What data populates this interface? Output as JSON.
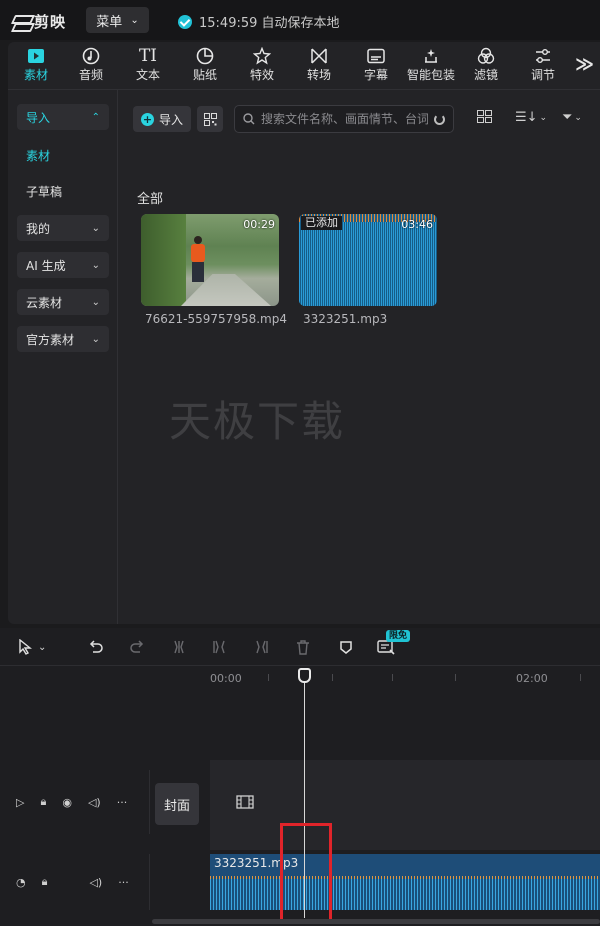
{
  "app": {
    "logo_text": "剪映",
    "menu_label": "菜单",
    "save_status": "15:49:59 自动保存本地"
  },
  "toolbar": {
    "tools": [
      {
        "label": "素材",
        "icon": "media-icon",
        "active": true
      },
      {
        "label": "音频",
        "icon": "audio-icon"
      },
      {
        "label": "文本",
        "icon": "text-icon"
      },
      {
        "label": "贴纸",
        "icon": "sticker-icon"
      },
      {
        "label": "特效",
        "icon": "effects-icon"
      },
      {
        "label": "转场",
        "icon": "transition-icon"
      },
      {
        "label": "字幕",
        "icon": "subtitle-icon"
      },
      {
        "label": "智能包装",
        "icon": "smart-package-icon"
      },
      {
        "label": "滤镜",
        "icon": "filter-icon"
      },
      {
        "label": "调节",
        "icon": "adjust-icon"
      }
    ],
    "more": "≫"
  },
  "sidebar": {
    "items": [
      {
        "label": "导入",
        "expandable": true,
        "active": true
      },
      {
        "label": "素材",
        "selected": true
      },
      {
        "label": "子草稿"
      },
      {
        "label": "我的",
        "expandable": true
      },
      {
        "label": "AI 生成",
        "expandable": true
      },
      {
        "label": "云素材",
        "expandable": true
      },
      {
        "label": "官方素材",
        "expandable": true
      }
    ]
  },
  "content": {
    "import_label": "导入",
    "search_placeholder": "搜索文件名称、画面情节、台词",
    "section_label": "全部",
    "media": [
      {
        "name": "76621-559757958.mp4",
        "duration": "00:29",
        "type": "video"
      },
      {
        "name": "3323251.mp3",
        "duration": "03:46",
        "type": "audio",
        "tag": "已添加"
      }
    ],
    "watermark": "天极下载"
  },
  "timeline": {
    "limited_badge": "限免",
    "ruler": [
      "00:00",
      "02:00"
    ],
    "cover_label": "封面",
    "audio_clip_name": "3323251.mp3"
  },
  "colors": {
    "accent": "#2ad4e0",
    "highlight": "#e0242a",
    "audio_clip": "#1e4d78"
  }
}
